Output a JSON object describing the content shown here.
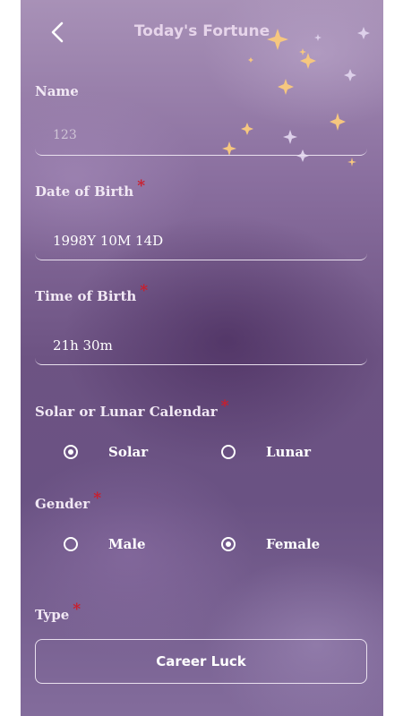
{
  "header": {
    "title": "Today's Fortune",
    "back_icon": "chevron-left-icon"
  },
  "form": {
    "name": {
      "label": "Name",
      "value": "123",
      "required": false
    },
    "birth_date": {
      "label": "Date of Birth",
      "value": "1998Y 10M 14D",
      "required": true
    },
    "birth_time": {
      "label": "Time of Birth",
      "value": "21h 30m",
      "required": true
    },
    "calendar": {
      "label": "Solar or Lunar Calendar",
      "required": true,
      "options": [
        "Solar",
        "Lunar"
      ],
      "selected": "Solar"
    },
    "gender": {
      "label": "Gender",
      "required": true,
      "options": [
        "Male",
        "Female"
      ],
      "selected": "Female"
    },
    "type": {
      "label": "Type",
      "required": true,
      "value": "Career Luck"
    }
  },
  "required_mark": "*",
  "colors": {
    "accent": "#cc1d2b",
    "text": "#ffffff",
    "background_top": "#a891b7",
    "background_mid": "#6d5383"
  }
}
